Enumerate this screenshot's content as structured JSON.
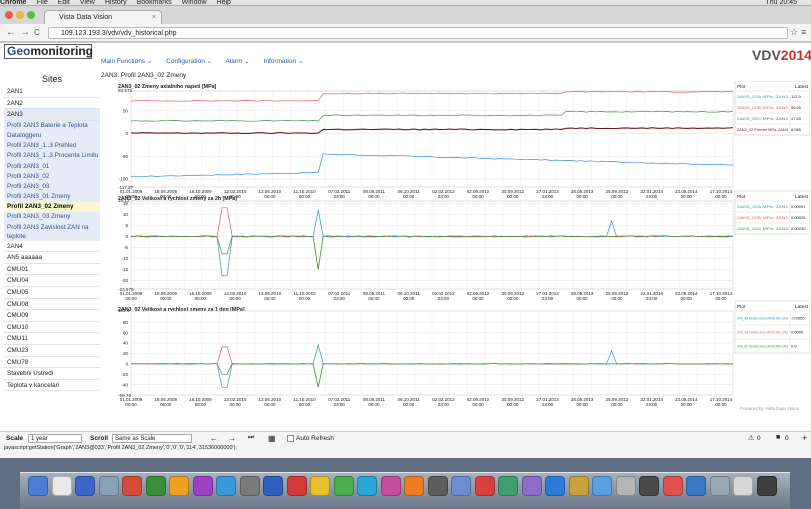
{
  "menubar": {
    "items": [
      "Chrome",
      "File",
      "Edit",
      "View",
      "History",
      "Bookmarks",
      "Window",
      "Help"
    ],
    "clock": "Thu 20:45"
  },
  "tab": {
    "title": "Vista Data Vision",
    "close": "×"
  },
  "toolbar": {
    "back": "←",
    "forward": "→",
    "reload": "C",
    "url": "109.123.193.3/vdv/vdv_historical.php",
    "star": "☆",
    "menu": "≡"
  },
  "logo": {
    "prefix": "Geo",
    "rest": "monitoring"
  },
  "brand": {
    "vdv": "VDV",
    "year": "2014"
  },
  "nav": [
    "Main Functions ⌄",
    "Configuration ⌄",
    "Alarm ⌄",
    "Information ⌄"
  ],
  "sidebar": {
    "title": "Sites",
    "items": [
      {
        "label": "2AN1",
        "type": "site"
      },
      {
        "label": "2AN2",
        "type": "site"
      },
      {
        "label": "2AN3",
        "type": "grp"
      },
      {
        "label": "Profil 2AN3 Baterie a Teplota",
        "type": "sub"
      },
      {
        "label": "Dataloggeru",
        "type": "sub"
      },
      {
        "label": "Profil 2AN3_1..3 Prehled",
        "type": "sub"
      },
      {
        "label": "Profil 2AN3_1..3 Procenta Limitu",
        "type": "sub"
      },
      {
        "label": "Profil 2AN3_01",
        "type": "sub"
      },
      {
        "label": "Profil 2AN3_02",
        "type": "sub"
      },
      {
        "label": "Profil 2AN3_03",
        "type": "sub"
      },
      {
        "label": "Profil 2AN3_01 Zmeny",
        "type": "sub"
      },
      {
        "label": "Profil 2AN3_02 Zmeny",
        "type": "sel"
      },
      {
        "label": "Profil 2AN3_03 Zmeny",
        "type": "sub"
      },
      {
        "label": "Profil 2AN3 Zavislost ZAN na teplote",
        "type": "sub2"
      },
      {
        "label": "2AN4",
        "type": "site"
      },
      {
        "label": "AN5 aaaaaa",
        "type": "site"
      },
      {
        "label": "CMU01",
        "type": "site"
      },
      {
        "label": "CMU04",
        "type": "site"
      },
      {
        "label": "CMU05",
        "type": "site"
      },
      {
        "label": "CMU08",
        "type": "site"
      },
      {
        "label": "CMU09",
        "type": "site"
      },
      {
        "label": "CMU10",
        "type": "site"
      },
      {
        "label": "CMU11",
        "type": "site"
      },
      {
        "label": "CMU23",
        "type": "site"
      },
      {
        "label": "CMU78",
        "type": "site"
      },
      {
        "label": "Stavebni Ustredi",
        "type": "site"
      },
      {
        "label": "Teplota v kancelari",
        "type": "site"
      }
    ]
  },
  "main_title": "2AN3: Profil 2AN3_02 Zmeny",
  "x_ticks": [
    "01.01.2009\n00:00",
    "18.06.2009\n00:00",
    "16.10.2009\n00:00",
    "12.02.2010\n00:00",
    "13.06.2010\n00:00",
    "11.10.2010\n00:00",
    "07.02.2011\n23:00",
    "08.06.2011\n00:00",
    "06.10.2011\n00:00",
    "02.02.2012\n23:00",
    "02.06.2012\n00:00",
    "30.09.2012\n00:00",
    "27.01.2013\n23:00",
    "28.05.2013\n00:00",
    "25.09.2013\n00:00",
    "22.01.2014\n23:00",
    "23.05.2014\n00:00",
    "17.10.2014\n00:00"
  ],
  "chart_data": [
    {
      "type": "line",
      "title": "2AN3_02 Zmeny axialniho napeti [MPa]",
      "y_max_label": "93.578",
      "y_min_label": "-117.57",
      "y_ticks": [
        50,
        0,
        -50,
        -100
      ],
      "ylim": [
        -117.57,
        93.578
      ],
      "legend": {
        "col1": "Plot",
        "col2": "Latest",
        "rows": [
          [
            "2AN3_02A MPa: 2AN3",
            "112.9"
          ],
          [
            "2AN3_02B MPa: 2AN3",
            "95.00"
          ],
          [
            "2AN3_02C MPa: 2AN3",
            "47.55"
          ],
          [
            "2AN3_02 Prumer MPa: 2AN3",
            "8.985"
          ]
        ]
      },
      "series": [
        {
          "name": "2AN3_02A MPa: 2AN3",
          "color": "#3a8fd8"
        },
        {
          "name": "2AN3_02B MPa: 2AN3",
          "color": "#e06060"
        },
        {
          "name": "2AN3_02C MPa: 2AN3",
          "color": "#3a9a3a"
        },
        {
          "name": "2AN3_02 Prumer MPa: 2AN3",
          "color": "#7a1515"
        }
      ]
    },
    {
      "type": "line",
      "title": "2AN3_02 Velikost a rychlost zmeny za 2h [MPa]",
      "y_max_label": "16.12",
      "y_min_label": "-23.978",
      "y_ticks": [
        15,
        10,
        5,
        0,
        -5,
        -10,
        -15,
        -20
      ],
      "ylim": [
        -23.978,
        16.12
      ],
      "legend": {
        "col1": "Plot",
        "col2": "Latest",
        "rows": [
          [
            "2AN3_02A MPa: 2AN3",
            "0.00091"
          ],
          [
            "2AN3_02B MPa: 2AN3",
            "0.00025"
          ],
          [
            "2AN3_02C MPa: 2AN3",
            "0.00230"
          ]
        ]
      },
      "series": [
        {
          "name": "2AN3_02A MPa: 2AN3",
          "color": "#3a8fd8"
        },
        {
          "name": "2AN3_02B MPa: 2AN3",
          "color": "#e06060"
        },
        {
          "name": "2AN3_02C MPa: 2AN3",
          "color": "#3a9a3a"
        }
      ]
    },
    {
      "type": "line",
      "title": "2AN3_02 Velikost a rychlost zmeny za 1 den [MPa]",
      "y_max_label": "101.4",
      "y_min_label": "-59.76",
      "y_ticks": [
        80,
        60,
        40,
        20,
        0,
        -20,
        -40
      ],
      "ylim": [
        -59.76,
        101.4
      ],
      "legend": {
        "col1": "Plot",
        "col2": "Latest",
        "rows": [
          [
            "2AN3_02A Rychlost zmeny 2AN/24h MPa: 2AN3",
            "-0.0650"
          ],
          [
            "2AN3_02B Rychlost zmeny 2AN/24h MPa: 2AN3",
            "0.0000"
          ],
          [
            "2AN3_02C Rychlost zmeny 2AN/24h MPa: 2AN3",
            "0.0"
          ]
        ]
      },
      "series": [
        {
          "name": "2AN3_02A Rychlost zmeny 2AN/24h MPa: 2AN3",
          "color": "#3a8fd8"
        },
        {
          "name": "2AN3_02B Rychlost zmeny 2AN/24h MPa: 2AN3",
          "color": "#e06060"
        },
        {
          "name": "2AN3_02C Rychlost zmeny 2AN/24h MPa: 2AN3",
          "color": "#3a9a3a"
        }
      ]
    }
  ],
  "footer": "Powered by Vista Data Vision",
  "bottom": {
    "scale_label": "Scale",
    "scale_value": "1 year",
    "scroll_label": "Scroll",
    "scroll_value": "Same as Scale",
    "auto_refresh": "Auto Refresh",
    "alarms": "0",
    "msgs": "0",
    "plus": "+"
  },
  "status": "javascript:getStation('Graph','2AN3@033','Profil 2AN3_02 Zmeny','0','0','0','114','31536000000');"
}
